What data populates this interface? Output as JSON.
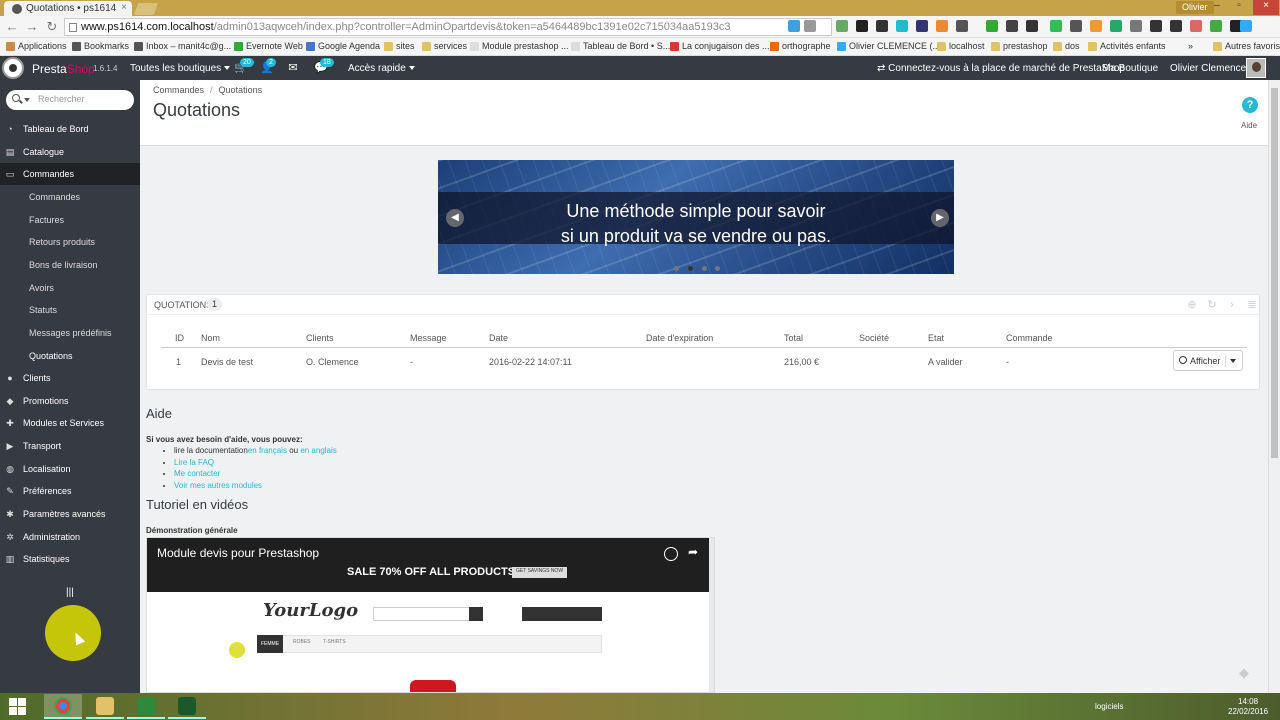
{
  "browser": {
    "tab_title": "Quotations • ps1614",
    "user_chip": "Olivier",
    "url_host": "www.ps1614.com.localhost",
    "url_path": "/admin013aqwceh/index.php?controller=AdminOpartdevis&token=a5464489bc1391e02c715034aa5193c3",
    "bookmarks": [
      "Applications",
      "Bookmarks",
      "Inbox – manit4c@g...",
      "Evernote Web",
      "Google Agenda",
      "sites",
      "services",
      "Module prestashop ...",
      "Tableau de Bord • S...",
      "La conjugaison des ...",
      "orthographe",
      "Olivier CLEMENCE (...",
      "localhost",
      "prestashop",
      "dos",
      "Activités enfants"
    ],
    "bookmarks_more": "»",
    "other_bookmarks": "Autres favoris"
  },
  "topnav": {
    "brand_presta": "Presta",
    "brand_shop": "Shop",
    "version": "1.6.1.4",
    "shops": "Toutes les boutiques",
    "orders_count": "20",
    "customers_count": "2",
    "messages_count": "18",
    "quick_access": "Accès rapide",
    "marketplace": "Connectez-vous à la place de marché de PrestaShop",
    "my_shop": "Ma Boutique",
    "user_name": "Olivier Clemence"
  },
  "sidebar": {
    "search_placeholder": "Rechercher",
    "items": [
      "Tableau de Bord",
      "Catalogue",
      "Commandes"
    ],
    "subitems": [
      "Commandes",
      "Factures",
      "Retours produits",
      "Bons de livraison",
      "Avoirs",
      "Statuts",
      "Messages prédéfinis",
      "Quotations"
    ],
    "items_after": [
      "Clients",
      "Promotions",
      "Modules et Services",
      "Transport",
      "Localisation",
      "Préférences",
      "Paramètres avancés",
      "Administration",
      "Statistiques"
    ]
  },
  "page": {
    "breadcrumb": [
      "Commandes",
      "Quotations"
    ],
    "title": "Quotations",
    "help_label": "Aide"
  },
  "banner": {
    "line1": "Une méthode simple pour savoir",
    "line2": "si un produit va se vendre ou pas."
  },
  "quotations": {
    "panel_title": "Quotations",
    "count": "1",
    "columns": [
      "ID",
      "Nom",
      "Clients",
      "Message",
      "Date",
      "Date d'expiration",
      "Total",
      "Société",
      "Etat",
      "Commande"
    ],
    "rows": [
      {
        "id": "1",
        "name": "Devis de test",
        "client": "O. Clemence",
        "message": "-",
        "date": "2016-02-22 14:07:11",
        "expiration": "",
        "total": "216,00 €",
        "company": "",
        "state": "A valider",
        "order": "-"
      }
    ],
    "view_button": "Afficher"
  },
  "help": {
    "title": "Aide",
    "intro": "Si vous avez besoin d'aide, vous pouvez:",
    "doc_prefix": "lire la documentation",
    "doc_fr": "en français",
    "doc_or": " ou ",
    "doc_en": "en anglais",
    "faq": "Lire la FAQ",
    "contact": "Me contacter",
    "modules": "Voir mes autres modules"
  },
  "tutorial": {
    "title": "Tutoriel en vidéos",
    "demo_title": "Démonstration générale",
    "video_title": "Module devis pour Prestashop",
    "video_promo": "SALE 70% OFF ALL PRODUCTS",
    "video_promo_btn": "GET SAVINGS NOW",
    "video_logo": "YourLogo",
    "video_tabs": [
      "FEMME",
      "ROBES",
      "T-SHIRTS"
    ]
  },
  "taskbar": {
    "tray_label": "logiciels",
    "time": "14:08",
    "date": "22/02/2016"
  }
}
